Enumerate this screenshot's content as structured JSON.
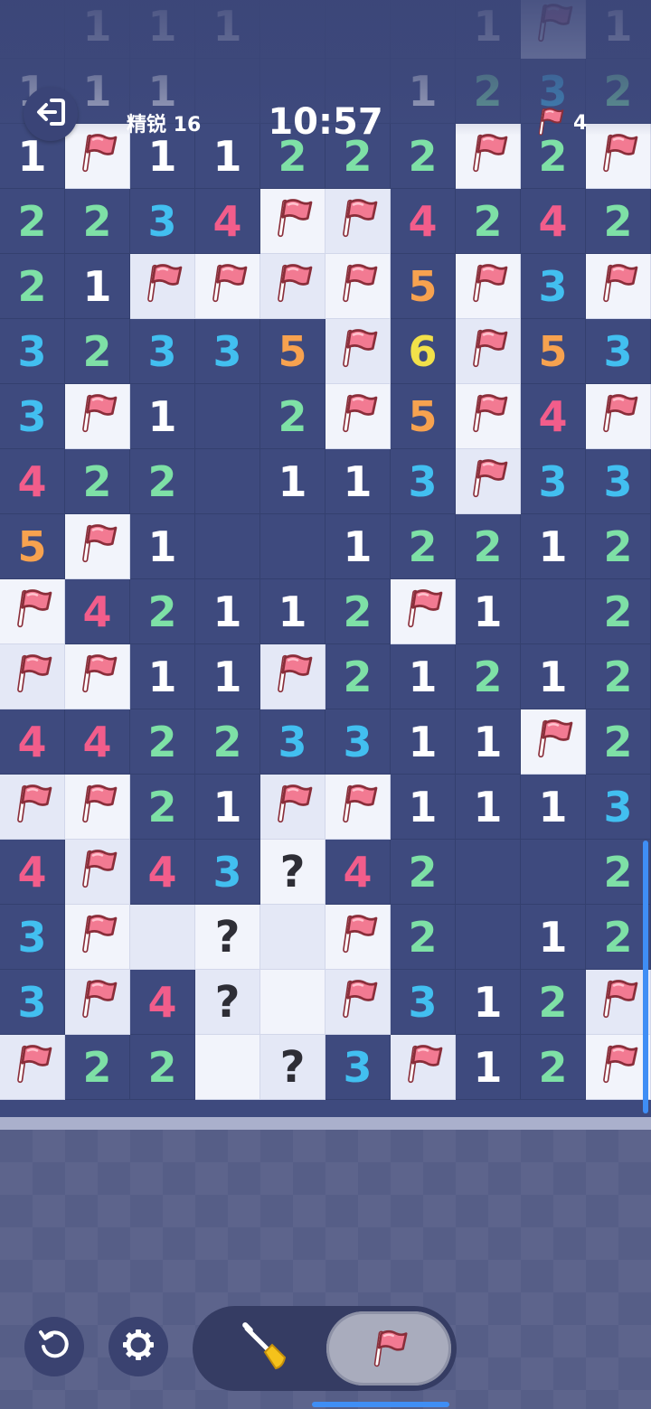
{
  "hud": {
    "difficulty_label": "精锐 16",
    "timer": "10:57",
    "flags_remaining": "4"
  },
  "colors": {
    "1": "#ffffff",
    "2": "#7ee0a6",
    "3": "#42bff0",
    "4": "#f25d8b",
    "5": "#f7a24f",
    "6": "#f2e14a",
    "flag": "#f27a92",
    "accent_blue": "#3f8ef5"
  },
  "board": {
    "cols": 10,
    "legend": "F = flagged hidden cell, ? = question-marked hidden cell, . = hidden blank cell, 0 = revealed empty cell, digit = revealed count",
    "rows": [
      [
        "0",
        "1",
        "1",
        "1",
        "0",
        "0",
        "0",
        "1",
        "F",
        "1"
      ],
      [
        "1",
        "1",
        "1",
        "0",
        "0",
        "0",
        "1",
        "2",
        "3",
        "2"
      ],
      [
        "1",
        "F",
        "1",
        "1",
        "2",
        "2",
        "2",
        "F",
        "2",
        "F"
      ],
      [
        "2",
        "2",
        "3",
        "4",
        "F",
        "F",
        "4",
        "2",
        "4",
        "2"
      ],
      [
        "2",
        "1",
        "F",
        "F",
        "F",
        "F",
        "5",
        "F",
        "3",
        "F"
      ],
      [
        "3",
        "2",
        "3",
        "3",
        "5",
        "F",
        "6",
        "F",
        "5",
        "3"
      ],
      [
        "3",
        "F",
        "1",
        "0",
        "2",
        "F",
        "5",
        "F",
        "4",
        "F"
      ],
      [
        "4",
        "2",
        "2",
        "0",
        "1",
        "1",
        "3",
        "F",
        "3",
        "3"
      ],
      [
        "5",
        "F",
        "1",
        "0",
        "0",
        "1",
        "2",
        "2",
        "1",
        "2"
      ],
      [
        "F",
        "4",
        "2",
        "1",
        "1",
        "2",
        "F",
        "1",
        "0",
        "2"
      ],
      [
        "F",
        "F",
        "1",
        "1",
        "F",
        "2",
        "1",
        "2",
        "1",
        "2"
      ],
      [
        "4",
        "4",
        "2",
        "2",
        "3",
        "3",
        "1",
        "1",
        "F",
        "2"
      ],
      [
        "F",
        "F",
        "2",
        "1",
        "F",
        "F",
        "1",
        "1",
        "1",
        "3"
      ],
      [
        "4",
        "F",
        "4",
        "3",
        "?",
        "4",
        "2",
        "0",
        "0",
        "2"
      ],
      [
        "3",
        "F",
        ".",
        "?",
        ".",
        "F",
        "2",
        "0",
        "1",
        "2"
      ],
      [
        "3",
        "F",
        "4",
        "?",
        ".",
        "F",
        "3",
        "1",
        "2",
        "F"
      ],
      [
        "F",
        "2",
        "2",
        ".",
        "?",
        "3",
        "F",
        "1",
        "2",
        "F"
      ]
    ]
  },
  "controls": {
    "restart_icon": "restart-icon",
    "settings_icon": "gear-icon",
    "dig_mode_icon": "shovel-icon",
    "flag_mode_icon": "flag-icon",
    "active_mode": "flag"
  }
}
